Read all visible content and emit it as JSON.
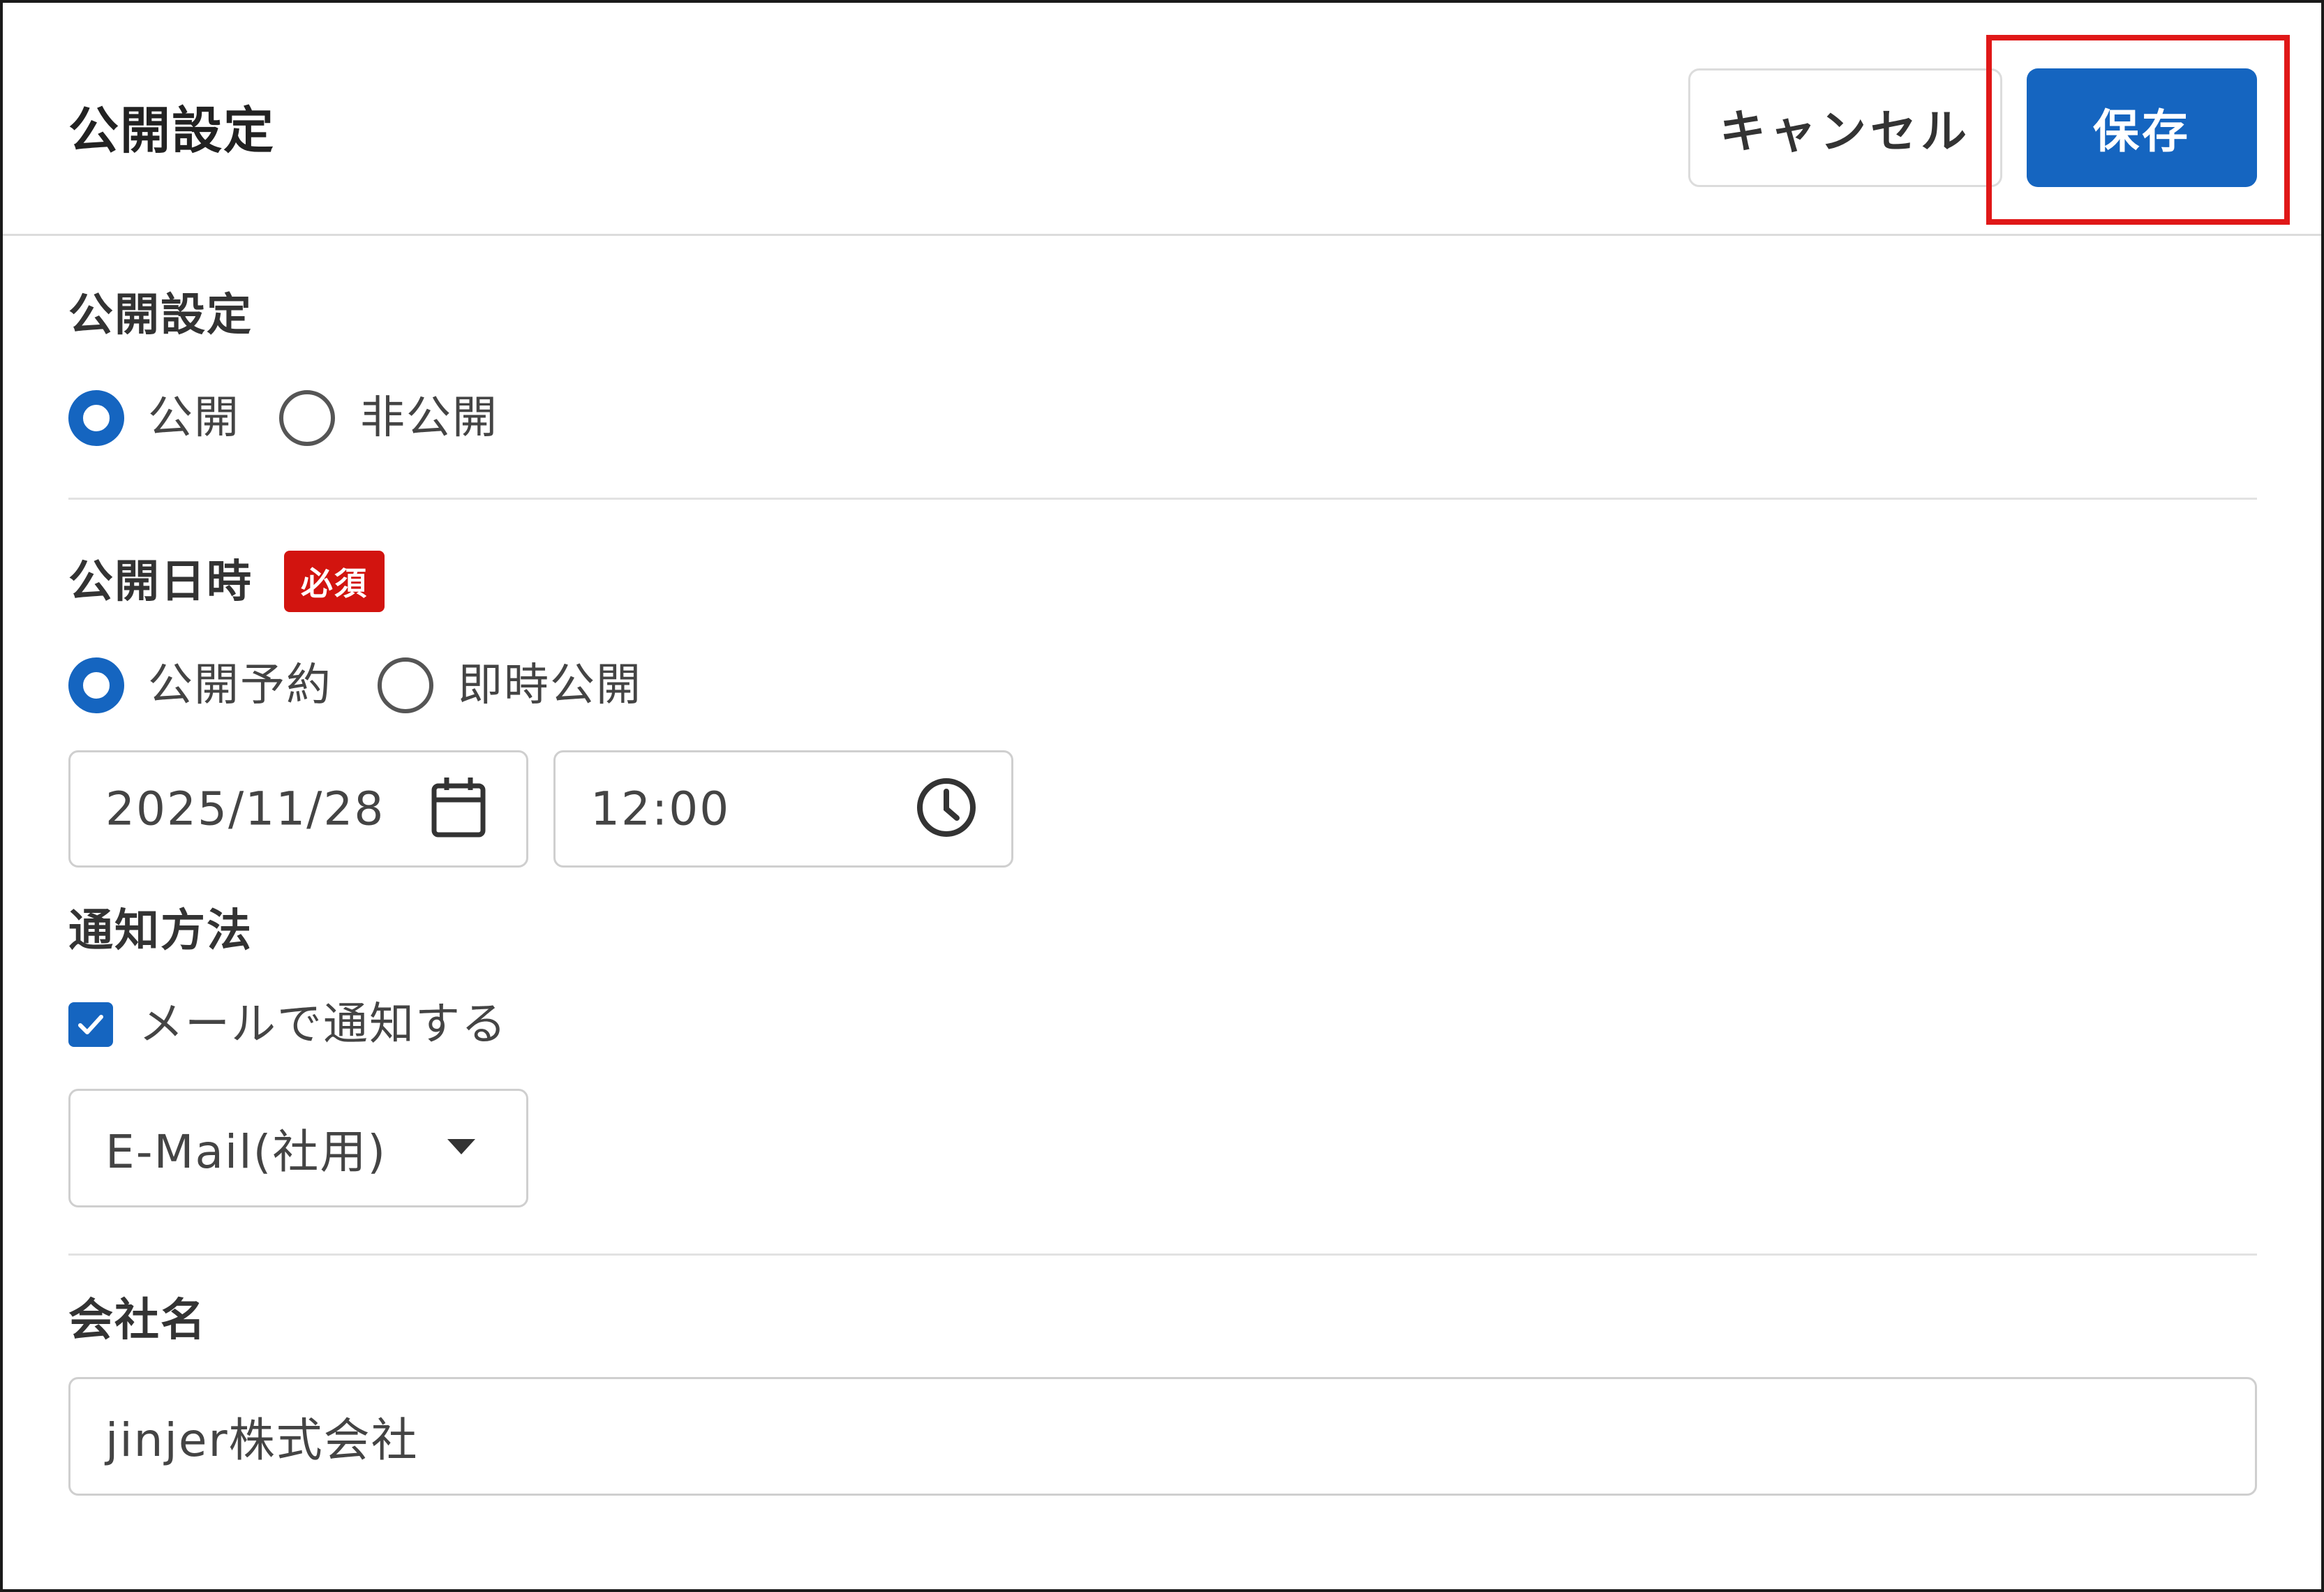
{
  "header": {
    "title": "公開設定",
    "cancel_label": "キャンセル",
    "save_label": "保存"
  },
  "visibility": {
    "label": "公開設定",
    "options": [
      {
        "label": "公開",
        "selected": true
      },
      {
        "label": "非公開",
        "selected": false
      }
    ]
  },
  "publish_datetime": {
    "label": "公開日時",
    "required_badge": "必須",
    "options": [
      {
        "label": "公開予約",
        "selected": true
      },
      {
        "label": "即時公開",
        "selected": false
      }
    ],
    "date_value": "2025/11/28",
    "time_value": "12:00"
  },
  "notification": {
    "label": "通知方法",
    "email_checkbox_label": "メールで通知する",
    "email_checked": true,
    "selected_option": "E-Mail(社用)"
  },
  "company": {
    "label": "会社名",
    "value": "jinjer株式会社"
  },
  "colors": {
    "accent": "#1565c0",
    "required": "#d2140f",
    "highlight": "#e01818"
  },
  "icons": [
    "calendar-icon",
    "clock-icon",
    "caret-down-icon",
    "check-icon"
  ]
}
